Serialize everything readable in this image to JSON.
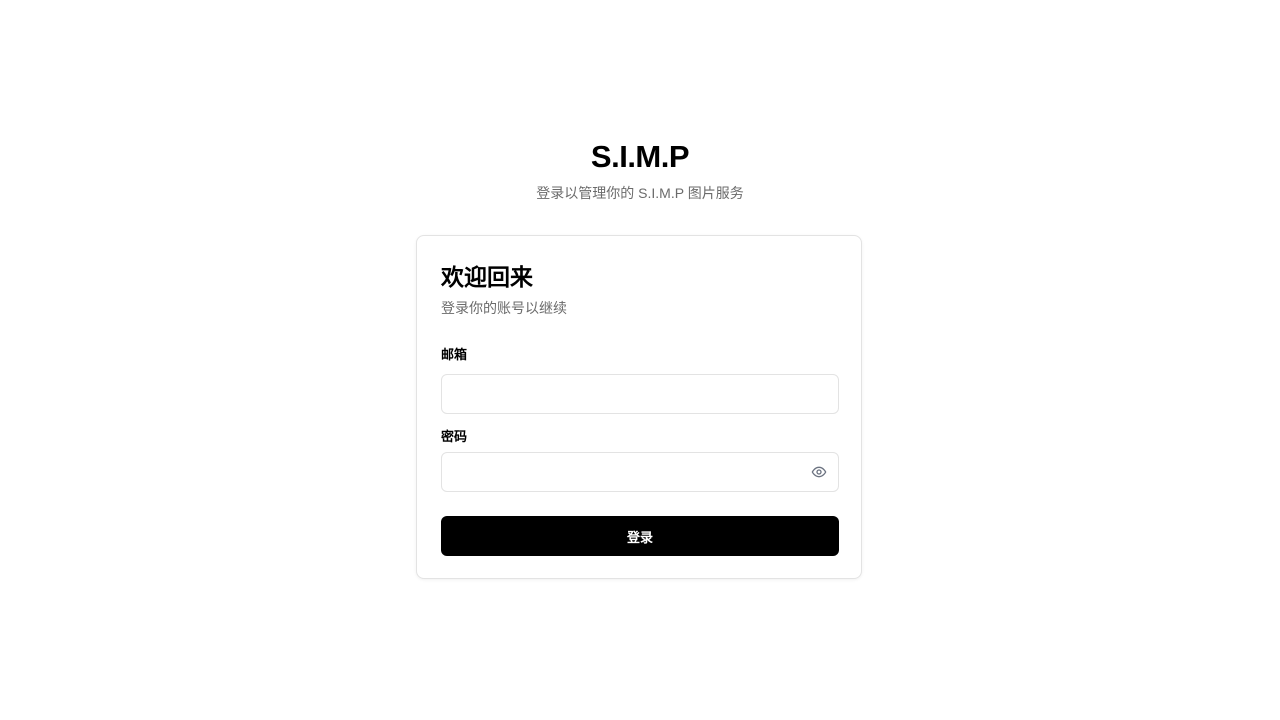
{
  "brand": {
    "title": "S.I.M.P",
    "subtitle": "登录以管理你的 S.I.M.P 图片服务"
  },
  "login_card": {
    "title": "欢迎回来",
    "subtitle": "登录你的账号以继续",
    "email": {
      "label": "邮箱",
      "value": "",
      "placeholder": ""
    },
    "password": {
      "label": "密码",
      "value": "",
      "placeholder": "",
      "toggle_icon": "eye-icon"
    },
    "submit_label": "登录"
  },
  "colors": {
    "background": "#ffffff",
    "button_background": "#000000",
    "button_text": "#ffffff",
    "muted_text": "#6b6b6b",
    "border": "#e3e3e3",
    "icon": "#6b7280"
  }
}
